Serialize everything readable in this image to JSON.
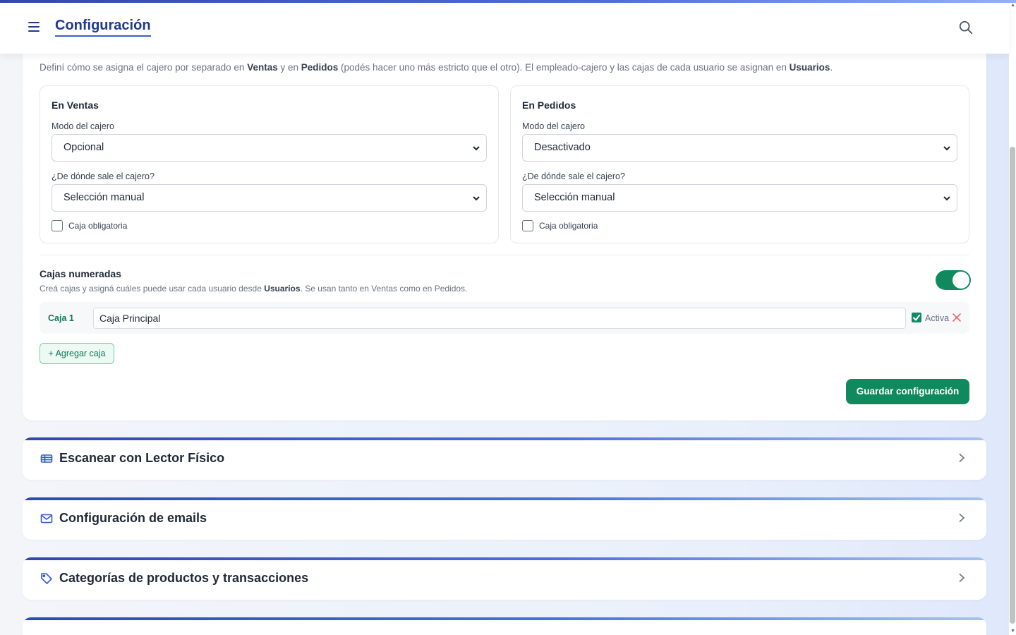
{
  "header": {
    "title": "Configuración"
  },
  "intro": {
    "part1": "Definí cómo se asigna el cajero por separado en ",
    "ventas": "Ventas",
    "part2": " y en ",
    "pedidos": "Pedidos",
    "part3": " (podés hacer uno más estricto que el otro). El empleado-cajero y las cajas de cada usuario se asignan en ",
    "usuarios": "Usuarios",
    "part4": "."
  },
  "ventas": {
    "title": "En Ventas",
    "mode_label": "Modo del cajero",
    "mode_value": "Opcional",
    "source_label": "¿De dónde sale el cajero?",
    "source_value": "Selección manual",
    "checkbox_label": "Caja obligatoria",
    "checkbox_checked": false
  },
  "pedidos": {
    "title": "En Pedidos",
    "mode_label": "Modo del cajero",
    "mode_value": "Desactivado",
    "source_label": "¿De dónde sale el cajero?",
    "source_value": "Selección manual",
    "checkbox_label": "Caja obligatoria",
    "checkbox_checked": false
  },
  "cajas": {
    "title": "Cajas numeradas",
    "desc_part1": "Creá cajas y asigná cuáles puede usar cada usuario desde ",
    "desc_usuarios": "Usuarios",
    "desc_part2": ". Se usan tanto en Ventas como en Pedidos.",
    "enabled": true,
    "items": [
      {
        "label": "Caja 1",
        "name": "Caja Principal",
        "active_label": "Activa",
        "active": true
      }
    ],
    "add_label": "+ Agregar caja"
  },
  "save_label": "Guardar configuración",
  "sections": [
    {
      "title": "Escanear con Lector Físico",
      "icon": "barcode-icon"
    },
    {
      "title": "Configuración de emails",
      "icon": "mail-icon"
    },
    {
      "title": "Categorías de productos y transacciones",
      "icon": "tag-icon"
    }
  ],
  "colors": {
    "primary_green": "#0f8a5f",
    "title_blue": "#1e3a8a",
    "accent_blue": "#3b5fc9"
  }
}
